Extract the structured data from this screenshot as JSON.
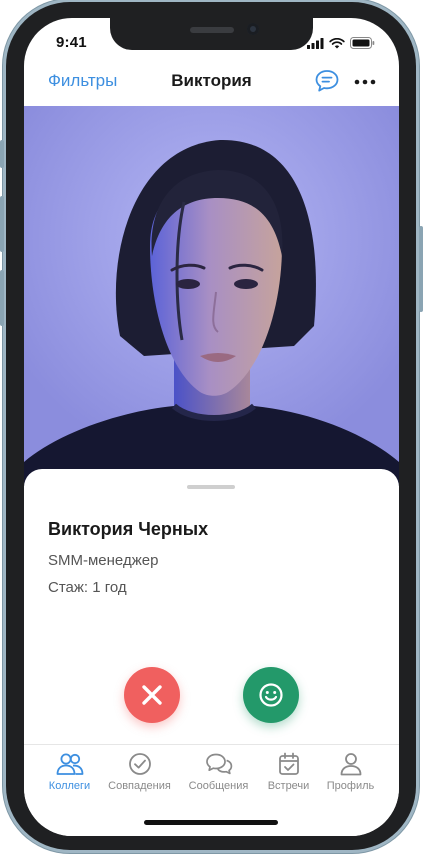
{
  "status_bar": {
    "time": "9:41"
  },
  "nav": {
    "filters_label": "Фильтры",
    "title": "Виктория"
  },
  "profile": {
    "full_name": "Виктория Черных",
    "role": "SMM-менеджер",
    "experience": "Стаж: 1 год"
  },
  "tabs": [
    {
      "label": "Коллеги",
      "icon": "people-icon",
      "active": true
    },
    {
      "label": "Совпадения",
      "icon": "check-circle-icon",
      "active": false
    },
    {
      "label": "Сообщения",
      "icon": "chat-bubbles-icon",
      "active": false
    },
    {
      "label": "Встречи",
      "icon": "calendar-check-icon",
      "active": false
    },
    {
      "label": "Профиль",
      "icon": "user-icon",
      "active": false
    }
  ],
  "colors": {
    "accent": "#3d8fe0",
    "reject": "#f0605f",
    "like": "#23996a",
    "photo_background": "#a3a5ec"
  }
}
